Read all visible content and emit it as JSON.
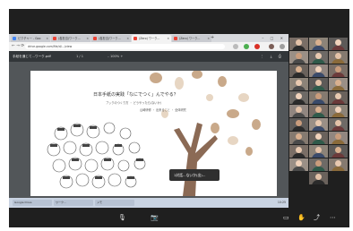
{
  "browser": {
    "tabs": [
      {
        "label": "ピクチャー - Goo",
        "color": "#4285f4"
      },
      {
        "label": "(各担当)ワーク...",
        "color": "#ea4335"
      },
      {
        "label": "(各担当)ワーク...",
        "color": "#ea4335"
      },
      {
        "label": "(Zero) ワーク...",
        "color": "#ea4335",
        "active": true
      },
      {
        "label": "(Zero) ワーク...",
        "color": "#ea4335"
      }
    ],
    "new_tab_glyph": "+",
    "window_controls": "–  □  ✕",
    "nav_glyphs": "←  →  ⟳",
    "url": "drive.google.com/file/d/.../view"
  },
  "viewer": {
    "doc_title": "手紙を通じて...ワーク.pdf",
    "page_indicator": "1 / 1",
    "zoom": "– 100% +",
    "right_glyphs": "⋮ ⤓ ⎙"
  },
  "slide": {
    "title": "日本手紙の実践「なにでつく」んでやる？",
    "subtitle_line1": "ブックのつくり方 ・ どうやったら(ないか)",
    "subtitle_line2": "山崎研修 ・ 出来ること ・ 全体研究",
    "bubble_text": "1対話...ないか(出)..."
  },
  "taskbar": {
    "items": [
      "Google Drive",
      "ワーク...",
      "メモ"
    ],
    "clock": "10:25"
  },
  "meeting": {
    "controls": [
      {
        "icon": "mic-icon",
        "glyph": "🎙"
      },
      {
        "icon": "camera-icon",
        "glyph": "📷"
      },
      {
        "icon": "captions-icon",
        "glyph": "▭"
      },
      {
        "icon": "hand-raise-icon",
        "glyph": "✋"
      },
      {
        "icon": "share-icon",
        "glyph": "⤴"
      },
      {
        "icon": "more-icon",
        "glyph": "⋯"
      }
    ]
  },
  "colors": {
    "meet_bg": "#1f1f1f",
    "tree_brown": "#8b6a55",
    "leaf_tan": "#c9a98a",
    "leaf_light": "#e7d6c3"
  }
}
